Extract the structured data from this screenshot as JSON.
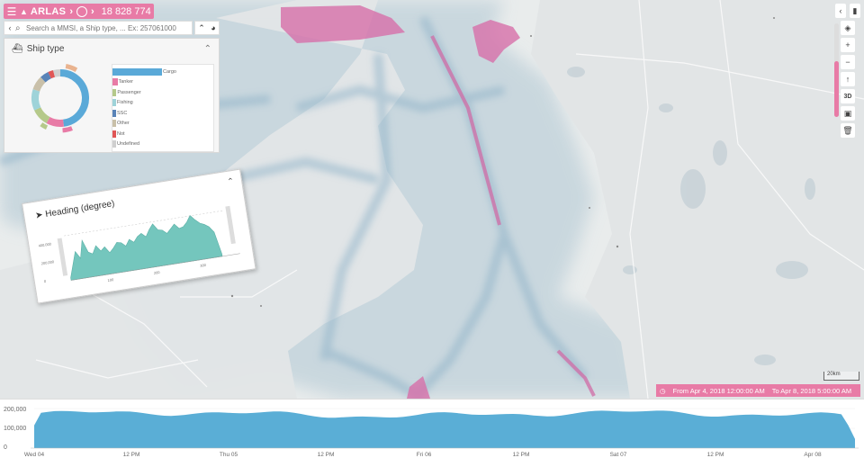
{
  "topbar": {
    "menu_icon": "menu-icon",
    "brand": "ARLAS",
    "count": "18 828 774"
  },
  "search": {
    "placeholder": "Search a MMSI, a Ship type, ... Ex: 257061000"
  },
  "ship_type": {
    "title": "Ship type",
    "legend": [
      {
        "label": "Cargo",
        "color": "#5aa9d8",
        "fill": 1.0
      },
      {
        "label": "Tanker",
        "color": "#e87ba6",
        "fill": 0.1
      },
      {
        "label": "Passenger",
        "color": "#b5c98a",
        "fill": 0.08
      },
      {
        "label": "Fishing",
        "color": "#9ed3d9",
        "fill": 0.06
      },
      {
        "label": "SSC",
        "color": "#5a84b8",
        "fill": 0.03
      },
      {
        "label": "Other",
        "color": "#c9c0a9",
        "fill": 0.02
      },
      {
        "label": "Not",
        "color": "#e05656",
        "fill": 0.02
      },
      {
        "label": "Undefined",
        "color": "#cfcfcf",
        "fill": 0.01
      }
    ]
  },
  "heading": {
    "title": "Heading (degree)",
    "y_ticks": [
      "400,000",
      "200,000",
      "0"
    ],
    "x_ticks": [
      "100",
      "200",
      "300"
    ]
  },
  "map": {
    "scale_label": "20km",
    "time_from": "From Apr 4, 2018 12:00:00 AM",
    "time_to": "To Apr 8, 2018 5:00:00 AM",
    "controls": [
      "chevron-left-icon",
      "bookmark-icon",
      "layers-icon",
      "zoom-in-icon",
      "zoom-out-icon",
      "compass-icon",
      "3d-button",
      "basemap-icon",
      "trash-icon"
    ]
  },
  "timeline": {
    "y_ticks": [
      "200,000",
      "100,000",
      "0"
    ],
    "x_ticks": [
      "Wed 04",
      "12 PM",
      "Thu 05",
      "12 PM",
      "Fri 06",
      "12 PM",
      "Sat 07",
      "12 PM",
      "Apr 08"
    ]
  },
  "colors": {
    "accent": "#e87ba6",
    "water": "#b9ccd6",
    "timeline": "#5aaed6"
  }
}
